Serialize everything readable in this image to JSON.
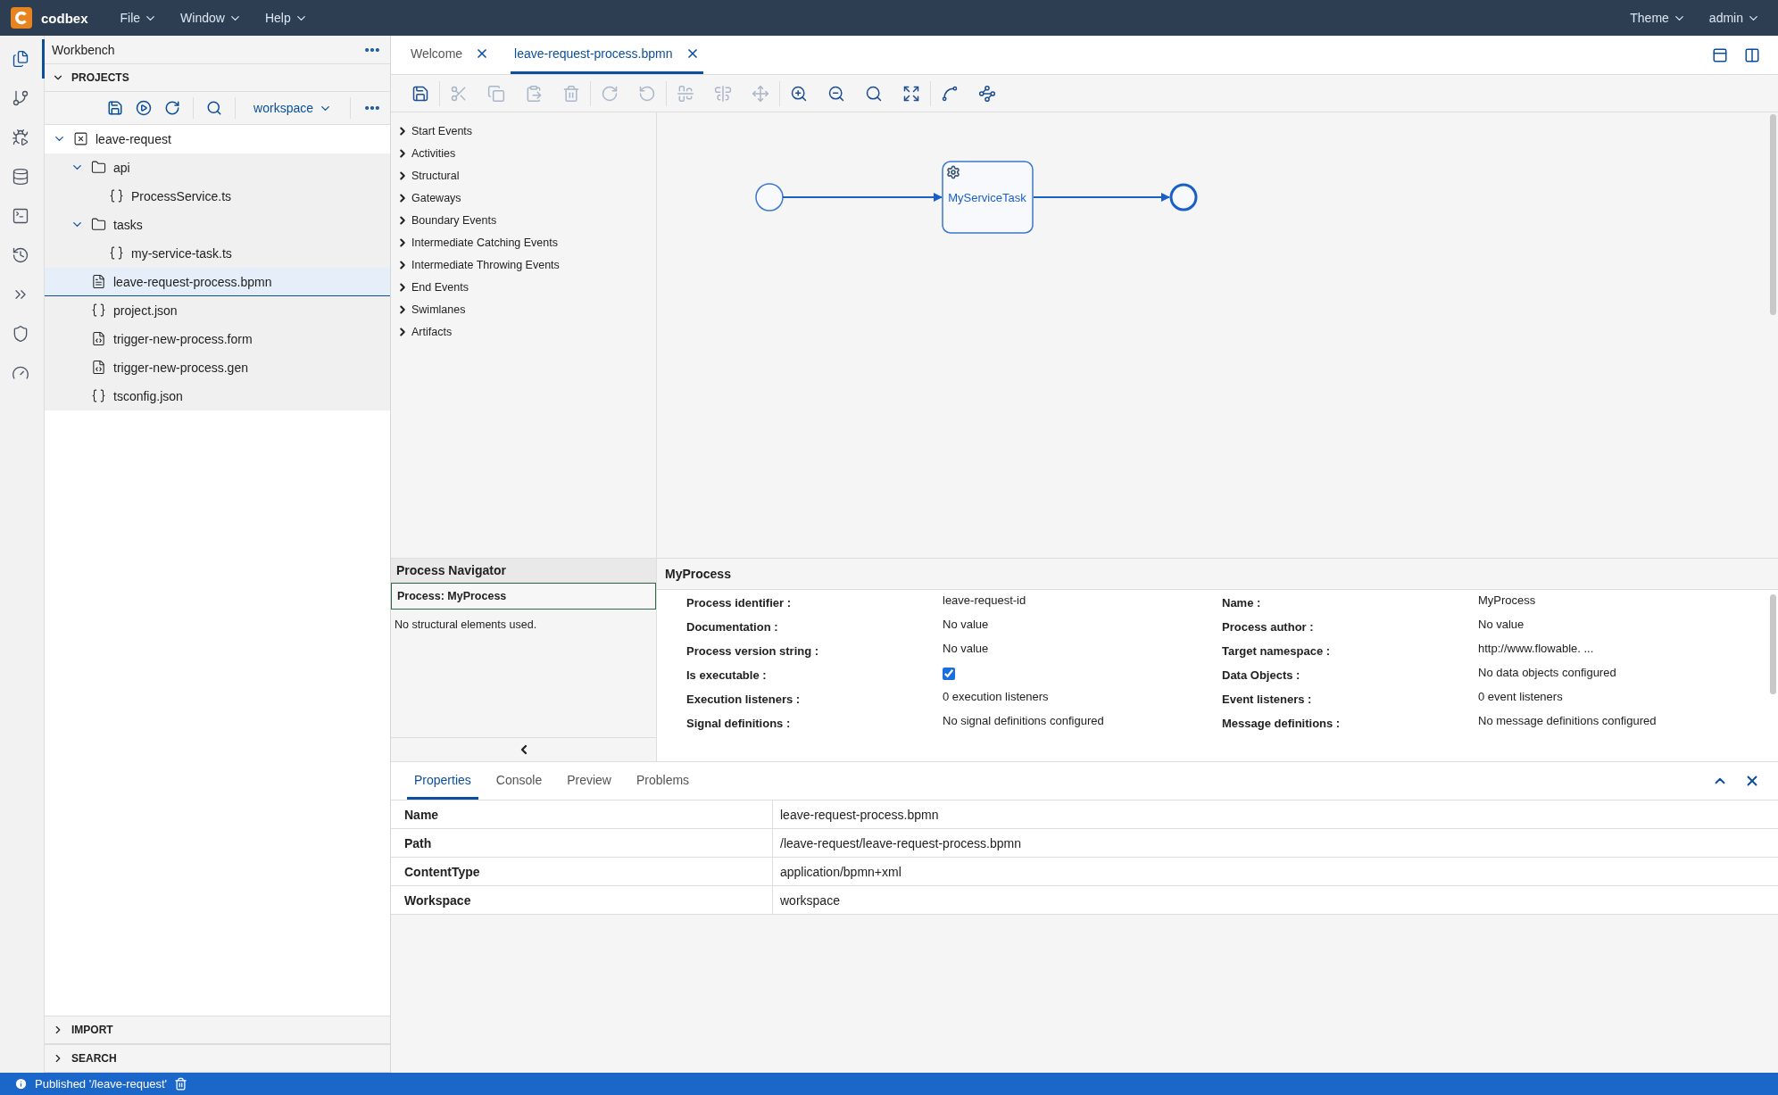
{
  "top_bar": {
    "brand": "codbex",
    "menus": [
      "File",
      "Window",
      "Help"
    ],
    "right_menus": [
      "Theme",
      "admin"
    ]
  },
  "activity_bar": [
    {
      "selected": true
    },
    {
      "selected": false
    },
    {
      "selected": false
    },
    {
      "selected": false
    },
    {
      "selected": false
    },
    {
      "selected": false
    },
    {
      "selected": false
    },
    {
      "selected": false
    },
    {
      "selected": false
    }
  ],
  "sidebar": {
    "title": "Workbench",
    "projects_label": "PROJECTS",
    "workspace": "workspace",
    "tree": [
      {
        "label": "leave-request",
        "kind": "project",
        "expanded": true,
        "selected": false,
        "children": [
          {
            "label": "api",
            "kind": "folder",
            "expanded": true,
            "selected": false,
            "children": [
              {
                "label": "ProcessService.ts",
                "kind": "code",
                "selected": false
              }
            ]
          },
          {
            "label": "tasks",
            "kind": "folder",
            "expanded": true,
            "selected": false,
            "children": [
              {
                "label": "my-service-task.ts",
                "kind": "code",
                "selected": false
              }
            ]
          },
          {
            "label": "leave-request-process.bpmn",
            "kind": "diagram",
            "selected": true
          },
          {
            "label": "project.json",
            "kind": "code",
            "selected": false
          },
          {
            "label": "trigger-new-process.form",
            "kind": "form",
            "selected": false
          },
          {
            "label": "trigger-new-process.gen",
            "kind": "form",
            "selected": false
          },
          {
            "label": "tsconfig.json",
            "kind": "code",
            "selected": false
          }
        ]
      }
    ],
    "sections": [
      "IMPORT",
      "SEARCH"
    ]
  },
  "editor_tabs": [
    {
      "label": "Welcome",
      "selected": false
    },
    {
      "label": "leave-request-process.bpmn",
      "selected": true
    }
  ],
  "toolbar": [
    {
      "disabled": false
    },
    {
      "disabled": true
    },
    {
      "disabled": true
    },
    {
      "disabled": true
    },
    {
      "disabled": true
    },
    {
      "disabled": true
    },
    {
      "disabled": true
    },
    {
      "disabled": true
    },
    {
      "disabled": true
    },
    {
      "disabled": true
    },
    {
      "disabled": false
    },
    {
      "disabled": false
    },
    {
      "disabled": false
    },
    {
      "disabled": false
    },
    {
      "disabled": false
    },
    {
      "disabled": false
    }
  ],
  "palette": [
    "Start Events",
    "Activities",
    "Structural",
    "Gateways",
    "Boundary Events",
    "Intermediate Catching Events",
    "Intermediate Throwing Events",
    "End Events",
    "Swimlanes",
    "Artifacts"
  ],
  "diagram": {
    "task_label": "MyServiceTask"
  },
  "navigator": {
    "title": "Process Navigator",
    "process": "Process: MyProcess",
    "note": "No structural elements used."
  },
  "properties_panel": {
    "title": "MyProcess",
    "fields": [
      {
        "label": "Process identifier :",
        "kind": "text",
        "value": "leave-request-id"
      },
      {
        "label": "Name :",
        "kind": "text",
        "value": "MyProcess"
      },
      {
        "label": "Documentation :",
        "kind": "text",
        "value": "No value"
      },
      {
        "label": "Process author :",
        "kind": "text",
        "value": "No value"
      },
      {
        "label": "Process version string :",
        "kind": "text",
        "value": "No value"
      },
      {
        "label": "Target namespace :",
        "kind": "text",
        "value": "http://www.flowable. ..."
      },
      {
        "label": "Is executable :",
        "kind": "checkbox",
        "checked": true
      },
      {
        "label": "Data Objects :",
        "kind": "text",
        "value": "No data objects configured"
      },
      {
        "label": "Execution listeners :",
        "kind": "text",
        "value": "0 execution listeners"
      },
      {
        "label": "Event listeners :",
        "kind": "text",
        "value": "0 event listeners"
      },
      {
        "label": "Signal definitions :",
        "kind": "text",
        "value": "No signal definitions configured"
      },
      {
        "label": "Message definitions :",
        "kind": "text",
        "value": "No message definitions configured"
      }
    ]
  },
  "bottom_tabs": [
    {
      "label": "Properties",
      "selected": true
    },
    {
      "label": "Console",
      "selected": false
    },
    {
      "label": "Preview",
      "selected": false
    },
    {
      "label": "Problems",
      "selected": false
    }
  ],
  "properties_table": [
    {
      "name": "Name",
      "value": "leave-request-process.bpmn"
    },
    {
      "name": "Path",
      "value": "/leave-request/leave-request-process.bpmn"
    },
    {
      "name": "ContentType",
      "value": "application/bpmn+xml"
    },
    {
      "name": "Workspace",
      "value": "workspace"
    }
  ],
  "status_bar": {
    "message": "Published '/leave-request'"
  }
}
